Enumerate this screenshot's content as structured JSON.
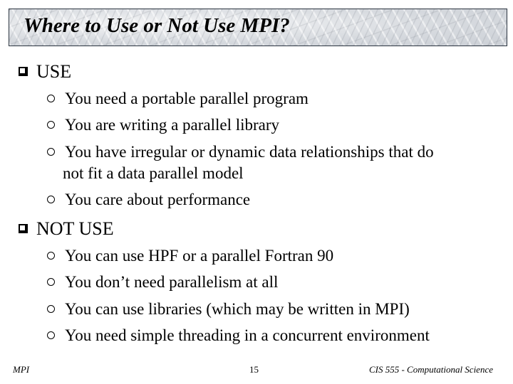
{
  "slide": {
    "title": "Where to Use or Not Use MPI?",
    "sections": [
      {
        "heading": "USE",
        "bullet_icon": "square-bullet-icon",
        "items": [
          {
            "text": "You need a portable parallel program"
          },
          {
            "text": "You are writing a parallel library"
          },
          {
            "text": "You have irregular or dynamic data relationships that do",
            "continuation": "not fit a data parallel model"
          },
          {
            "text": "You care about performance"
          }
        ]
      },
      {
        "heading": "NOT USE",
        "bullet_icon": "square-bullet-icon",
        "items": [
          {
            "text": "You can use HPF or a parallel Fortran 90"
          },
          {
            "text": "You don’t need parallelism at all"
          },
          {
            "text": "You can use libraries (which may be written in MPI)"
          },
          {
            "text": "You need simple threading in a concurrent environment"
          }
        ]
      }
    ],
    "sub_bullet_icon": "circle-bullet-icon"
  },
  "footer": {
    "left": "MPI",
    "page_number": "15",
    "right": "CIS 555 - Computational Science"
  }
}
